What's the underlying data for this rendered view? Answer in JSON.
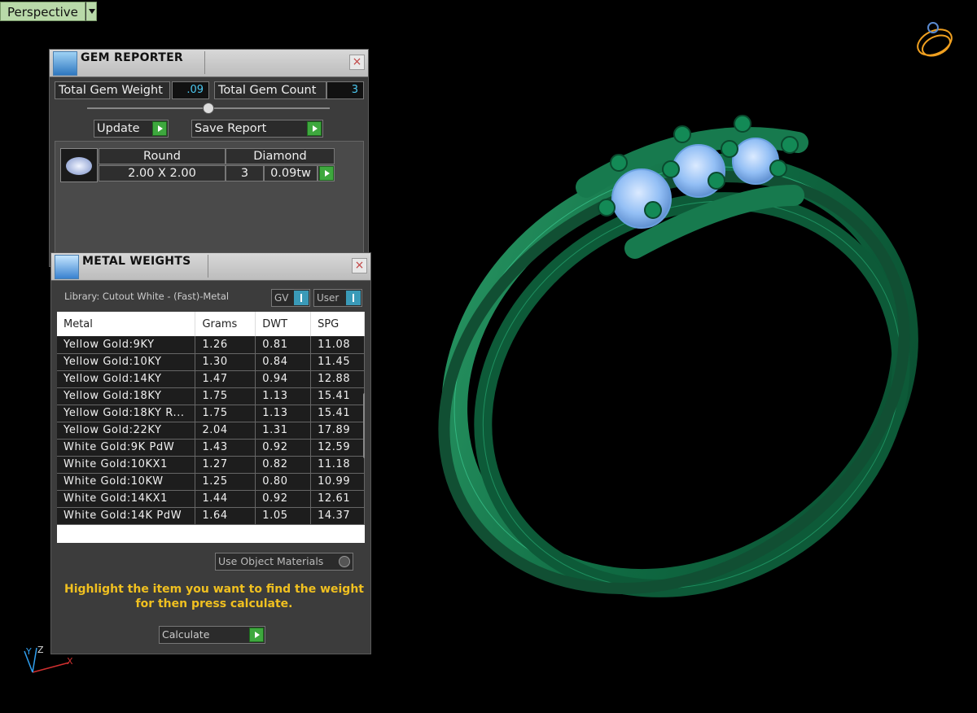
{
  "viewport": {
    "label": "Perspective"
  },
  "gem_reporter": {
    "title": "GEM REPORTER",
    "total_weight_label": "Total Gem Weight",
    "total_weight_value": ".09",
    "total_count_label": "Total Gem Count",
    "total_count_value": "3",
    "update_label": "Update",
    "save_report_label": "Save Report",
    "gem": {
      "shape": "Round",
      "type": "Diamond",
      "size": "2.00 X 2.00",
      "count": "3",
      "weight": "0.09tw"
    }
  },
  "metal_weights": {
    "title": "METAL WEIGHTS",
    "library": "Library: Cutout White - (Fast)-Metal",
    "gv_label": "GV",
    "user_label": "User",
    "columns": [
      "Metal",
      "Grams",
      "DWT",
      "SPG"
    ],
    "rows": [
      [
        "Yellow Gold:9KY",
        "1.26",
        "0.81",
        "11.08"
      ],
      [
        "Yellow Gold:10KY",
        "1.30",
        "0.84",
        "11.45"
      ],
      [
        "Yellow Gold:14KY",
        "1.47",
        "0.94",
        "12.88"
      ],
      [
        "Yellow Gold:18KY",
        "1.75",
        "1.13",
        "15.41"
      ],
      [
        "Yellow Gold:18KY R...",
        "1.75",
        "1.13",
        "15.41"
      ],
      [
        "Yellow Gold:22KY",
        "2.04",
        "1.31",
        "17.89"
      ],
      [
        "White Gold:9K PdW",
        "1.43",
        "0.92",
        "12.59"
      ],
      [
        "White Gold:10KX1",
        "1.27",
        "0.82",
        "11.18"
      ],
      [
        "White Gold:10KW",
        "1.25",
        "0.80",
        "10.99"
      ],
      [
        "White Gold:14KX1",
        "1.44",
        "0.92",
        "12.61"
      ],
      [
        "White Gold:14K PdW",
        "1.64",
        "1.05",
        "14.37"
      ]
    ],
    "use_object_materials": "Use Object Materials",
    "hint_line1": "Highlight the item you want to find the weight",
    "hint_line2": "for then press calculate.",
    "calculate_label": "Calculate"
  },
  "axes": {
    "x": "X",
    "y": "Y",
    "z": "Z"
  },
  "colors": {
    "ring_green": "#1a7a4e",
    "gem_blue": "#8ab8f0",
    "hint_yellow": "#f0c020"
  }
}
